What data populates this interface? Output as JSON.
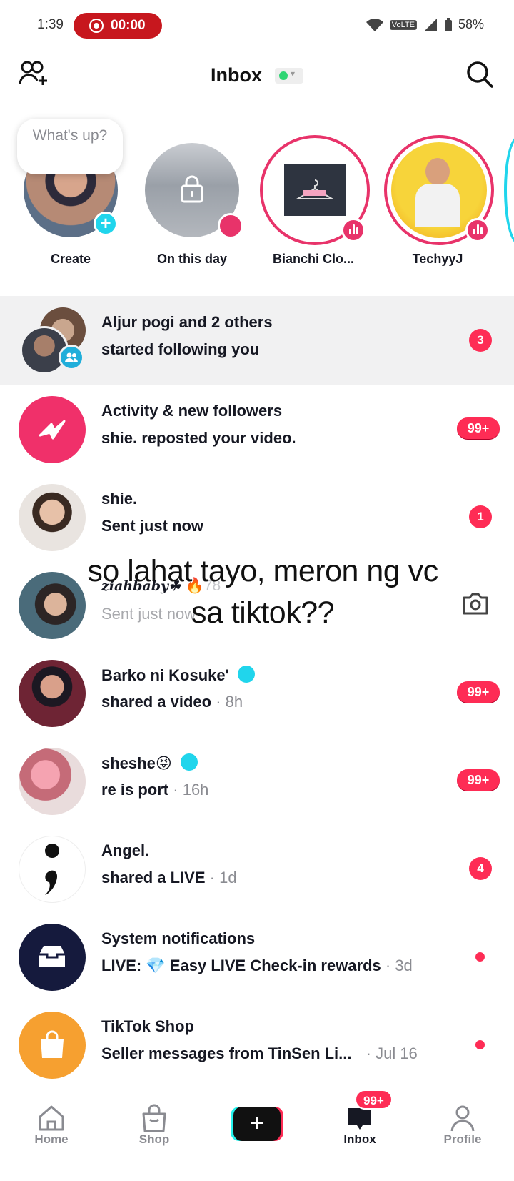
{
  "status_bar": {
    "time": "1:39",
    "recording": "00:00",
    "network": "VoLTE",
    "battery": "58%"
  },
  "header": {
    "title": "Inbox"
  },
  "stories": {
    "bubble": "What's up?",
    "items": [
      {
        "label": "Create"
      },
      {
        "label": "On this day"
      },
      {
        "label": "Bianchi Clo..."
      },
      {
        "label": "TechyyJ"
      }
    ]
  },
  "list": [
    {
      "line1": "Aljur pogi and 2 others",
      "line2": "started following you",
      "badge": "3"
    },
    {
      "line1": "Activity & new followers",
      "line2": "shie. reposted your video.",
      "badge": "99+"
    },
    {
      "line1": "shie.",
      "line2": "Sent just now",
      "badge": "1"
    },
    {
      "line1": "ziahbaby☘",
      "line1_extra": "78",
      "line2": "Sent just now"
    },
    {
      "line1": "Barko ni Kosuke'",
      "line2": "shared a video",
      "meta": "· 8h",
      "badge": "99+"
    },
    {
      "line1": "sheshe😝",
      "line2": "re is port",
      "meta": "· 16h",
      "badge": "99+"
    },
    {
      "line1": "Angel.",
      "line2": "shared a LIVE",
      "meta": "· 1d",
      "badge": "4"
    },
    {
      "line1": "System notifications",
      "line2": "LIVE: 💎 Easy LIVE Check-in rewards",
      "meta": "· 3d"
    },
    {
      "line1": "TikTok Shop",
      "line2": "Seller messages from TinSen Li...",
      "meta": "· Jul 16"
    }
  ],
  "overlay_text": "so lahat tayo, meron ng vc sa tiktok??",
  "nav": {
    "home": "Home",
    "shop": "Shop",
    "inbox": "Inbox",
    "inbox_badge": "99+",
    "profile": "Profile"
  },
  "colors": {
    "accent": "#fe2c55",
    "cyan": "#25f4ee",
    "text": "#161823",
    "muted": "#8a8b91"
  }
}
